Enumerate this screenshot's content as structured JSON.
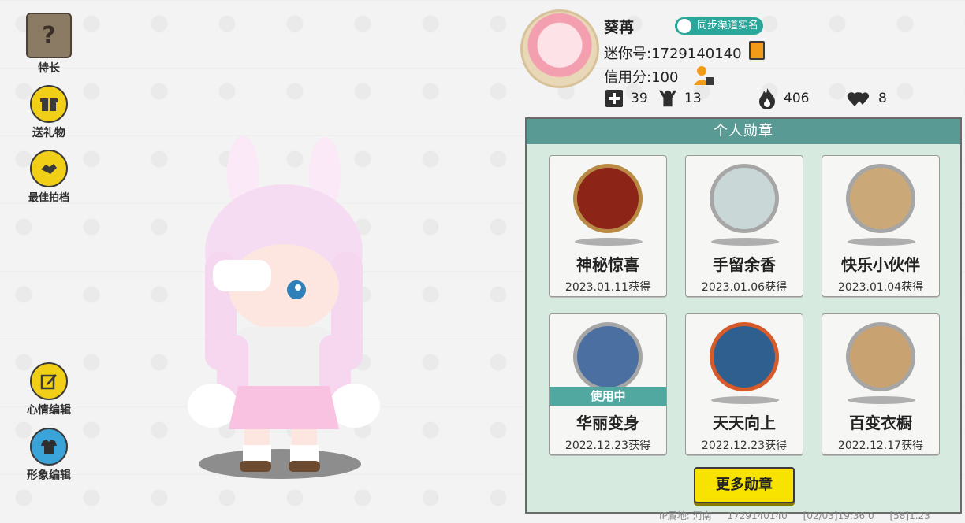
{
  "side_menu": {
    "talent": "特长",
    "send_gift": "送礼物",
    "best_partner": "最佳拍档",
    "mood_edit": "心情编辑",
    "avatar_edit": "形象编辑"
  },
  "profile": {
    "nickname": "葵苒",
    "realname_badge": "同步渠道实名",
    "mini_id_label": "迷你号:1729140140",
    "credit_label": "信用分:100",
    "stats": {
      "friends": "39",
      "followers": "13",
      "popularity": "406",
      "likes": "8"
    }
  },
  "medals": {
    "header": "个人勋章",
    "items": [
      {
        "name": "神秘惊喜",
        "date": "2023.01.11获得",
        "color": "#8c2418"
      },
      {
        "name": "手留余香",
        "date": "2023.01.06获得",
        "color": "#c9d8d6"
      },
      {
        "name": "快乐小伙伴",
        "date": "2023.01.04获得",
        "color": "#caa878"
      },
      {
        "name": "华丽变身",
        "date": "",
        "badge": "使用中",
        "color": "#4c6fa2"
      },
      {
        "name": "天天向上",
        "date": "2022.12.23获得",
        "color": "#2f5f8e"
      },
      {
        "name": "百变衣橱",
        "date": "2022.12.17获得",
        "color": "#c9a272"
      }
    ],
    "in_use_date": "2022.12.23获得",
    "more_button": "更多勋章"
  },
  "footer": {
    "ip": "IP属地: 河南",
    "id": "1729140140",
    "time": "[02/03]19:36 0",
    "version": "[58]1.23"
  },
  "colors": {
    "accent_yellow": "#f7e200",
    "panel_green": "#5a9a94",
    "panel_bg": "#d6eadf"
  }
}
